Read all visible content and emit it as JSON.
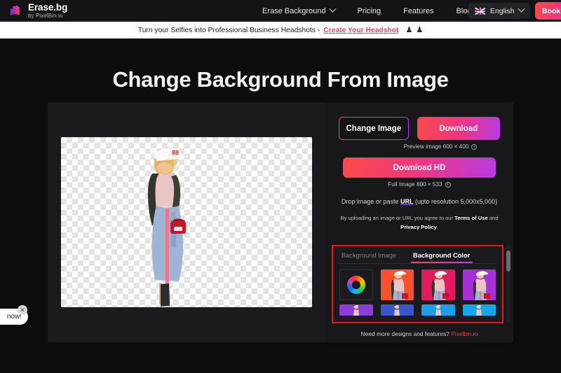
{
  "navbar": {
    "logo_title": "Erase.bg",
    "logo_subtitle": "by PixelBin.io",
    "links": [
      {
        "label": "Erase Background",
        "has_chevron": true
      },
      {
        "label": "Pricing",
        "has_chevron": false
      },
      {
        "label": "Features",
        "has_chevron": false
      },
      {
        "label": "Blogs",
        "has_chevron": false
      }
    ],
    "language": "English",
    "book_button": "Book a"
  },
  "promo": {
    "text": "Turn your Selfies into Professional Business Headshots -",
    "link": "Create Your Headshot",
    "icon_1": "person-female-icon",
    "icon_2": "person-male-icon"
  },
  "page": {
    "title": "Change Background From Image"
  },
  "canvas": {
    "alt": "transparent-checkerboard-preview"
  },
  "actions": {
    "change_image": "Change Image",
    "download": "Download",
    "preview_meta": "Preview image 600 × 400",
    "download_hd": "Download HD",
    "full_meta": "Full Image 800 × 533",
    "drop_prefix": "Drop image or paste",
    "drop_url": "URL",
    "drop_suffix": "(upto resolution 5,000x5,000)",
    "terms_1": "By uploading an image or URL you agree to our ",
    "terms_2": "Terms of Use",
    "terms_3": " and ",
    "terms_4": "Privacy Policy",
    "terms_5": "."
  },
  "background_picker": {
    "tabs": [
      {
        "label": "Background Image",
        "active": false
      },
      {
        "label": "Background Color",
        "active": true
      }
    ],
    "highlight_color": "#ef1515",
    "row_large": [
      {
        "name": "color-wheel-picker",
        "color": "wheel"
      },
      {
        "name": "swatch-orange-red",
        "color": "#f4512c"
      },
      {
        "name": "swatch-crimson-pink",
        "color": "#e01b5e"
      },
      {
        "name": "swatch-purple",
        "color": "#a430d6"
      }
    ],
    "row_small": [
      {
        "name": "swatch-violet",
        "color": "#8b3fd8"
      },
      {
        "name": "swatch-royal-blue",
        "color": "#3a56c8"
      },
      {
        "name": "swatch-sky-blue",
        "color": "#1c9fe8"
      },
      {
        "name": "swatch-cyan",
        "color": "#17a6e8"
      }
    ],
    "footer_text": "Need more designs and features?",
    "footer_link": "Pixelbin.io"
  },
  "chat_widget": {
    "text": "now!",
    "close_icon": "close-icon"
  }
}
